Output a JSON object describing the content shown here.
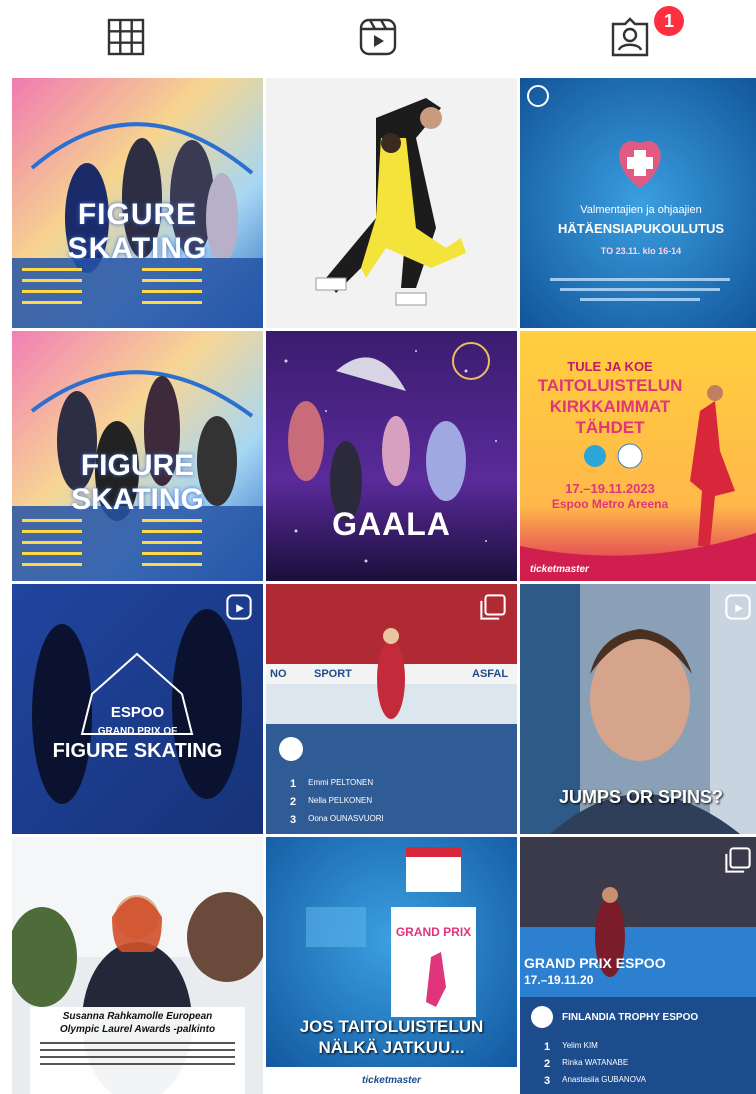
{
  "tabs": {
    "grid_icon": "grid-icon",
    "reels_icon": "reels-icon",
    "tagged_icon": "tagged-icon",
    "tagged_badge": "1"
  },
  "colors": {
    "badge": "#ff2f3f"
  },
  "posts": {
    "p1": {
      "title": "FIGURE SKATING"
    },
    "p3": {
      "line1": "Valmentajien ja ohjaajien",
      "title": "HÄTÄENSIAPUKOULUTUS",
      "date": "TO 23.11. klo 16-14"
    },
    "p4": {
      "title": "FIGURE SKATING"
    },
    "p5": {
      "title": "GAALA"
    },
    "p6": {
      "l1": "TULE JA KOE",
      "l2": "TAITOLUISTELUN",
      "l3": "KIRKKAIMMAT",
      "l4": "TÄHDET",
      "date": "17.–19.11.2023",
      "venue": "Espoo Metro Areena",
      "ticket": "ticketmaster"
    },
    "p7": {
      "city": "ESPOO",
      "l2": "GRAND PRIX OF",
      "l3": "FIGURE SKATING"
    },
    "p8": {
      "r1n": "1",
      "r1": "Emmi PELTONEN",
      "r2n": "2",
      "r2": "Nella PELKONEN",
      "r3n": "3",
      "r3": "Oona OUNASVUORI",
      "b1": "NO",
      "b2": "SPORT",
      "b3": "ASFAL"
    },
    "p9": {
      "title": "JUMPS OR SPINS?"
    },
    "p10": {
      "l1": "Susanna Rahkamolle European",
      "l2": "Olympic Laurel Awards -palkinto"
    },
    "p11": {
      "l1": "JOS TAITOLUISTELUN",
      "l2": "NÄLKÄ JATKUU...",
      "gp": "GRAND PRIX",
      "ticket": "ticketmaster"
    },
    "p12": {
      "banner": "GRAND PRIX ESPOO",
      "dates": "17.–19.11.20",
      "title": "FINLANDIA TROPHY ESPOO",
      "r1n": "1",
      "r1": "Yelim KIM",
      "r2n": "2",
      "r2": "Rinka WATANABE",
      "r3n": "3",
      "r3": "Anastasiia GUBANOVA"
    }
  }
}
